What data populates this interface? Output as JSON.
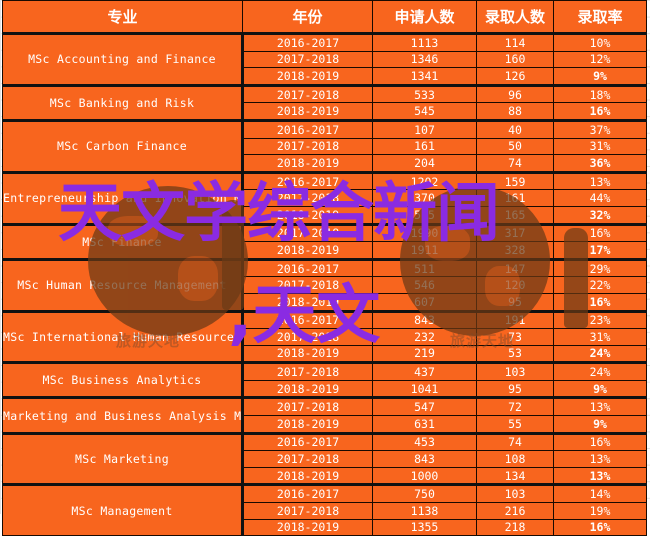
{
  "headers": {
    "major": "专业",
    "year": "年份",
    "applicants": "申请人数",
    "admitted": "录取人数",
    "rate": "录取率"
  },
  "groups": [
    {
      "major": "MSc Accounting and Finance",
      "rows": [
        {
          "year": "2016-2017",
          "applicants": "1113",
          "admitted": "114",
          "rate": "10%"
        },
        {
          "year": "2017-2018",
          "applicants": "1346",
          "admitted": "160",
          "rate": "12%"
        },
        {
          "year": "2018-2019",
          "applicants": "1341",
          "admitted": "126",
          "rate": "9%",
          "bold": true
        }
      ]
    },
    {
      "major": "MSc Banking and Risk",
      "rows": [
        {
          "year": "2017-2018",
          "applicants": "533",
          "admitted": "96",
          "rate": "18%"
        },
        {
          "year": "2018-2019",
          "applicants": "545",
          "admitted": "88",
          "rate": "16%",
          "bold": true
        }
      ]
    },
    {
      "major": "MSc Carbon Finance",
      "rows": [
        {
          "year": "2016-2017",
          "applicants": "107",
          "admitted": "40",
          "rate": "37%"
        },
        {
          "year": "2017-2018",
          "applicants": "161",
          "admitted": "50",
          "rate": "31%"
        },
        {
          "year": "2018-2019",
          "applicants": "204",
          "admitted": "74",
          "rate": "36%",
          "bold": true
        }
      ]
    },
    {
      "major": "Entrepreneurship and Innovation MSc",
      "rows": [
        {
          "year": "2016-2017",
          "applicants": "1202",
          "admitted": "159",
          "rate": "13%"
        },
        {
          "year": "2017-2018",
          "applicants": "370",
          "admitted": "161",
          "rate": "44%"
        },
        {
          "year": "2018-2019",
          "applicants": "515",
          "admitted": "165",
          "rate": "32%",
          "bold": true
        }
      ]
    },
    {
      "major": "MSc Finance",
      "rows": [
        {
          "year": "2017-2018",
          "applicants": "1990",
          "admitted": "317",
          "rate": "16%"
        },
        {
          "year": "2018-2019",
          "applicants": "1911",
          "admitted": "328",
          "rate": "17%",
          "bold": true
        }
      ]
    },
    {
      "major": "MSc Human Resource Management",
      "rows": [
        {
          "year": "2016-2017",
          "applicants": "511",
          "admitted": "147",
          "rate": "29%"
        },
        {
          "year": "2017-2018",
          "applicants": "546",
          "admitted": "120",
          "rate": "22%"
        },
        {
          "year": "2018-2019",
          "applicants": "607",
          "admitted": "95",
          "rate": "16%",
          "bold": true
        }
      ]
    },
    {
      "major": "MSc International Human Resource Management",
      "rows": [
        {
          "year": "2016-2017",
          "applicants": "843",
          "admitted": "191",
          "rate": "23%"
        },
        {
          "year": "2017-2018",
          "applicants": "232",
          "admitted": "73",
          "rate": "31%"
        },
        {
          "year": "2018-2019",
          "applicants": "219",
          "admitted": "53",
          "rate": "24%",
          "bold": true
        }
      ]
    },
    {
      "major": "MSc  Business Analytics",
      "rows": [
        {
          "year": "2017-2018",
          "applicants": "437",
          "admitted": "103",
          "rate": "24%"
        },
        {
          "year": "2018-2019",
          "applicants": "1041",
          "admitted": "95",
          "rate": "9%",
          "bold": true
        }
      ]
    },
    {
      "major": "Marketing and Business Analysis MSc",
      "rows": [
        {
          "year": "2017-2018",
          "applicants": "547",
          "admitted": "72",
          "rate": "13%"
        },
        {
          "year": "2018-2019",
          "applicants": "631",
          "admitted": "55",
          "rate": "9%",
          "bold": true
        }
      ]
    },
    {
      "major": "MSc Marketing",
      "rows": [
        {
          "year": "2016-2017",
          "applicants": "453",
          "admitted": "74",
          "rate": "16%"
        },
        {
          "year": "2017-2018",
          "applicants": "843",
          "admitted": "108",
          "rate": "13%"
        },
        {
          "year": "2018-2019",
          "applicants": "1000",
          "admitted": "134",
          "rate": "13%",
          "bold": true
        }
      ]
    },
    {
      "major": "MSc Management",
      "rows": [
        {
          "year": "2016-2017",
          "applicants": "750",
          "admitted": "103",
          "rate": "14%"
        },
        {
          "year": "2017-2018",
          "applicants": "1138",
          "admitted": "216",
          "rate": "19%"
        },
        {
          "year": "2018-2019",
          "applicants": "1355",
          "admitted": "218",
          "rate": "16%",
          "bold": true
        }
      ]
    }
  ],
  "watermark": {
    "text_left": "旅游天地",
    "text_right": "旅游天地"
  },
  "overlay": {
    "line1": "天文学综合新闻",
    "line2": ",天文"
  },
  "colors": {
    "cell_bg": "#f8651e",
    "text": "#ffffff",
    "overlay_text": "#8a2be2",
    "watermark": "#6b3a16"
  }
}
